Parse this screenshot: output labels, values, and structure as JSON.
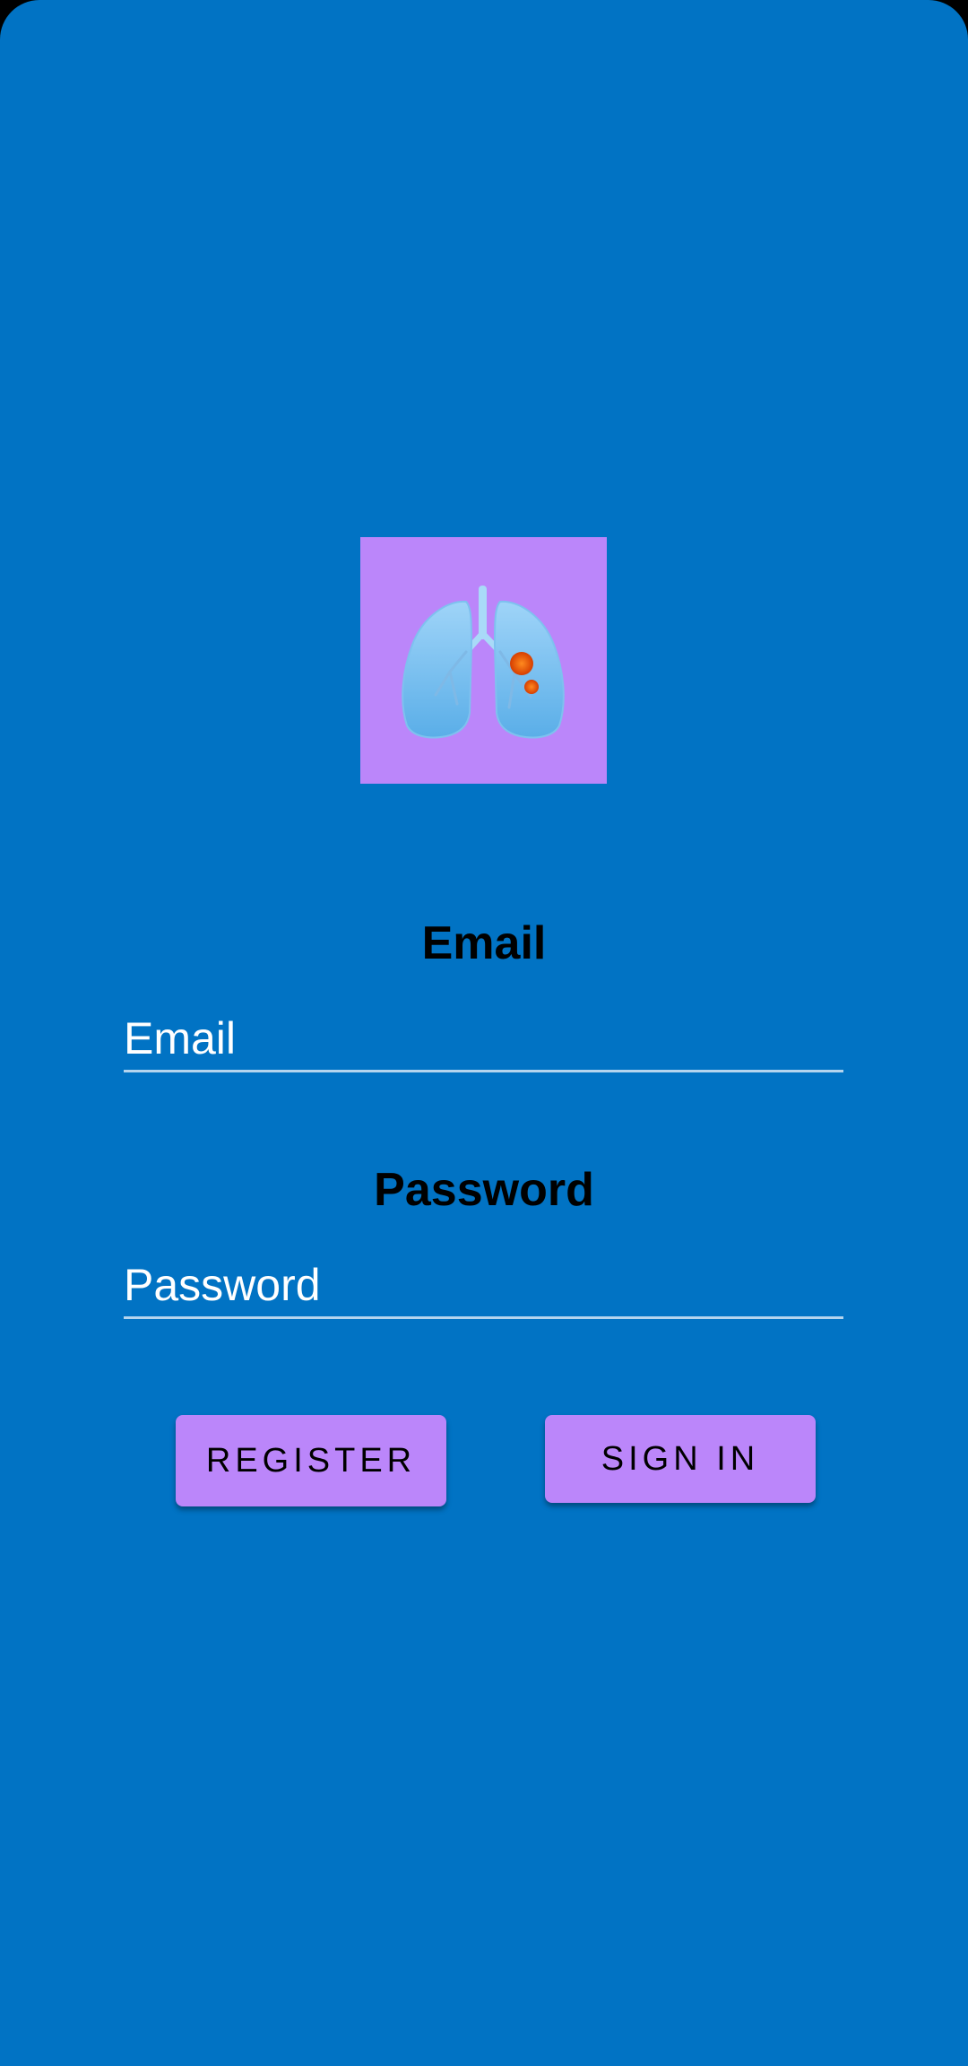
{
  "app": {
    "background_color": "#0173C4",
    "accent_color": "#BB86FA"
  },
  "logo": {
    "icon": "lungs-icon"
  },
  "form": {
    "email_label": "Email",
    "email_placeholder": "Email",
    "email_value": "",
    "password_label": "Password",
    "password_placeholder": "Password",
    "password_value": ""
  },
  "buttons": {
    "register_label": "REGISTER",
    "signin_label": "SIGN IN"
  }
}
